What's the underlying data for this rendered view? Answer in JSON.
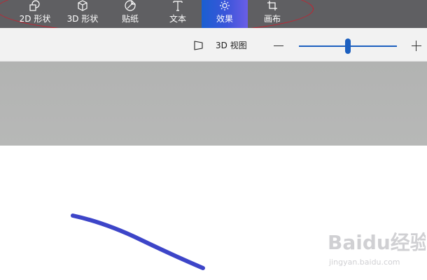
{
  "toolbar": {
    "tools": [
      {
        "id": "2d-shapes",
        "label": "2D 形状",
        "icon": "2d-shapes-icon"
      },
      {
        "id": "3d-shapes",
        "label": "3D 形状",
        "icon": "3d-cube-icon"
      },
      {
        "id": "stickers",
        "label": "贴纸",
        "icon": "sticker-icon"
      },
      {
        "id": "text",
        "label": "文本",
        "icon": "text-icon"
      },
      {
        "id": "effects",
        "label": "效果",
        "icon": "sun-icon",
        "active": true
      },
      {
        "id": "canvas",
        "label": "画布",
        "icon": "crop-icon"
      }
    ]
  },
  "subbar": {
    "view3d_label": "3D 视图",
    "view3d_icon": "3d-view-icon",
    "zoom": {
      "min_icon": "minus-icon",
      "max_icon": "plus-icon",
      "level_fraction": 0.5
    }
  },
  "stroke": {
    "color": "#3d45c8"
  },
  "watermark": {
    "brand": "Baidu经验",
    "domain": "jingyan.baidu.com"
  },
  "colors": {
    "toolbar_bg": "#5f5f62",
    "accent": "#1c5fbf",
    "active_tab": "#3c55da",
    "canvas_bg": "#b2b3b2"
  }
}
